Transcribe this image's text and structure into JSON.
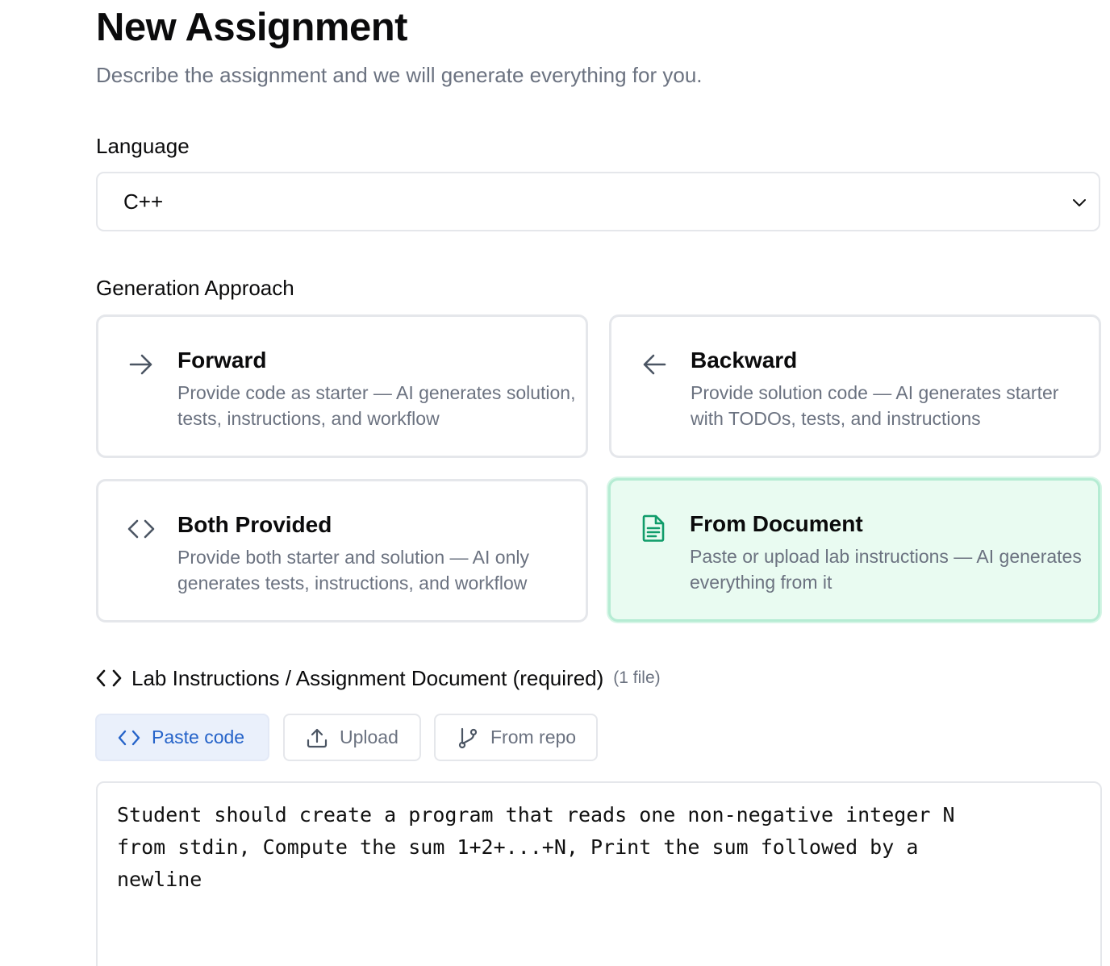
{
  "header": {
    "title": "New Assignment",
    "subtitle": "Describe the assignment and we will generate everything for you."
  },
  "language": {
    "label": "Language",
    "selected": "C++"
  },
  "approach": {
    "label": "Generation Approach",
    "selected": "From Document",
    "options": [
      {
        "title": "Forward",
        "description": "Provide code as starter — AI generates solution, tests, instructions, and workflow",
        "icon": "arrow-right-icon"
      },
      {
        "title": "Backward",
        "description": "Provide solution code — AI generates starter with TODOs, tests, and instructions",
        "icon": "arrow-left-icon"
      },
      {
        "title": "Both Provided",
        "description": "Provide both starter and solution — AI only generates tests, instructions, and workflow",
        "icon": "code-icon"
      },
      {
        "title": "From Document",
        "description": "Paste or upload lab instructions — AI generates everything from it",
        "icon": "document-icon"
      }
    ]
  },
  "document": {
    "label": "Lab Instructions / Assignment Document (required)",
    "count": "(1 file)",
    "tabs": [
      {
        "label": "Paste code",
        "icon": "code-icon"
      },
      {
        "label": "Upload",
        "icon": "upload-icon"
      },
      {
        "label": "From repo",
        "icon": "git-branch-icon"
      }
    ],
    "active_tab": "Paste code",
    "content": "Student should create a program that reads one non-negative integer N\nfrom stdin, Compute the sum 1+2+...+N, Print the sum followed by a\nnewline"
  },
  "colors": {
    "accent_green": "#109c6a",
    "selected_card_bg": "#e9fbf1",
    "active_tab_text": "#2563c9",
    "muted_text": "#6b7280"
  }
}
